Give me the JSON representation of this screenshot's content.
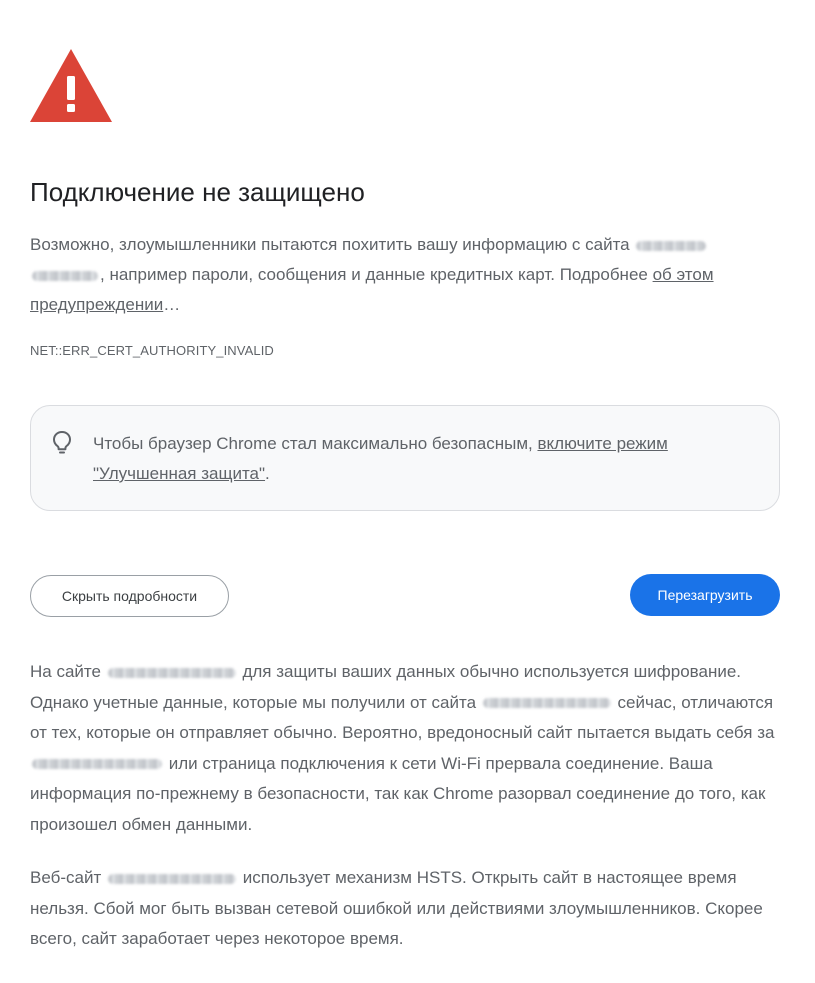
{
  "interstitial": {
    "title": "Подключение не защищено",
    "intro": {
      "part1": "Возможно, злоумышленники пытаются похитить вашу информацию с сайта",
      "part2": ", например пароли, сообщения и данные кредитных карт. Подробнее",
      "link": "об этом предупреждении",
      "ellipsis": "…"
    },
    "error_code": "NET::ERR_CERT_AUTHORITY_INVALID",
    "tip": {
      "icon": "lightbulb-icon",
      "text": "Чтобы браузер Chrome стал максимально безопасным,",
      "link": "включите режим \"Улучшенная защита\"",
      "end": "."
    },
    "buttons": {
      "details": "Скрыть подробности",
      "reload": "Перезагрузить"
    },
    "details": {
      "p1": {
        "s1": "На сайте",
        "s2": "для защиты ваших данных обычно используется шифрование. Однако учетные данные, которые мы получили от сайта",
        "s3": "сейчас, отличаются от тех, которые он отправляет обычно. Вероятно, вредоносный сайт пытается выдать себя за",
        "s4": "или страница подключения к сети Wi-Fi прервала соединение. Ваша информация по-прежнему в безопасности, так как Chrome разорвал соединение до того, как произошел обмен данными."
      },
      "p2": {
        "s1": "Веб-сайт",
        "s2": "использует механизм HSTS. Открыть сайт в настоящее время нельзя. Сбой мог быть вызван сетевой ошибкой или действиями злоумышленников. Скорее всего, сайт заработает через некоторое время."
      }
    },
    "colors": {
      "warning_red": "#db4437",
      "primary_blue": "#1a73e8",
      "text_secondary": "#5f6368",
      "title_text": "#202124"
    },
    "icons": {
      "warning": "warning-triangle-icon"
    }
  }
}
